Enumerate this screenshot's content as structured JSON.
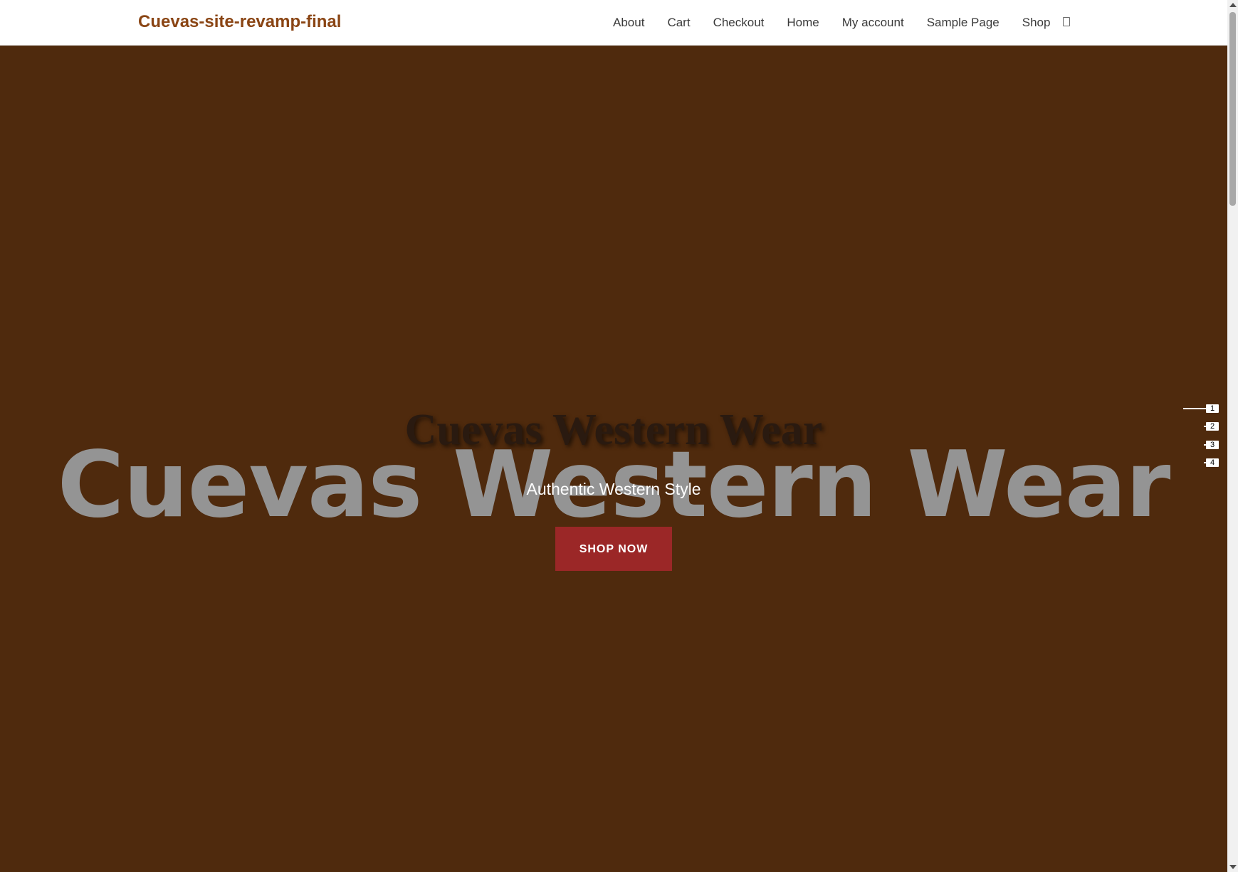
{
  "header": {
    "site_title": "Cuevas-site-revamp-final",
    "nav": [
      "About",
      "Cart",
      "Checkout",
      "Home",
      "My account",
      "Sample Page",
      "Shop"
    ],
    "cart_icon": "cart-icon"
  },
  "hero": {
    "background_color": "#4f2a0d",
    "bg_title": "Cuevas Western Wear",
    "title": "Cuevas Western Wear",
    "subtitle": "Authentic Western Style",
    "cta_label": "SHOP NOW",
    "cta_color": "#9b2727"
  },
  "slider": {
    "slides": [
      "1",
      "2",
      "3",
      "4"
    ],
    "active_index": 0
  },
  "colors": {
    "brand": "#8a4514"
  }
}
